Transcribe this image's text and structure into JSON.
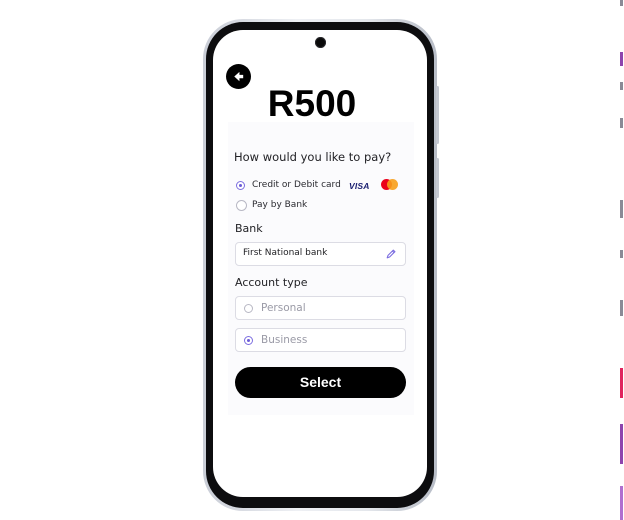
{
  "header": {
    "back_icon": "arrow-left-circle-icon",
    "amount": "R500"
  },
  "payment": {
    "question": "How would you like to pay?",
    "methods": [
      {
        "label": "Credit or Debit card",
        "selected": true,
        "icons": [
          "visa-logo",
          "mastercard-logo"
        ]
      },
      {
        "label": "Pay by Bank",
        "selected": false
      }
    ],
    "card_brands": {
      "visa": "VISA"
    }
  },
  "bank": {
    "label": "Bank",
    "value": "First National bank",
    "edit_icon": "pencil-icon"
  },
  "account_type": {
    "label": "Account type",
    "options": [
      {
        "label": "Personal",
        "selected": false
      },
      {
        "label": "Business",
        "selected": true
      }
    ]
  },
  "actions": {
    "select_label": "Select"
  },
  "colors": {
    "accent": "#6b5bd6",
    "button_bg": "#000000",
    "button_text": "#ffffff",
    "visa_blue": "#1a1f71",
    "mastercard_red": "#eb001b",
    "mastercard_orange": "#f79e1b",
    "edge_pink": "#e0245e",
    "edge_purple": "#8e44ad"
  }
}
